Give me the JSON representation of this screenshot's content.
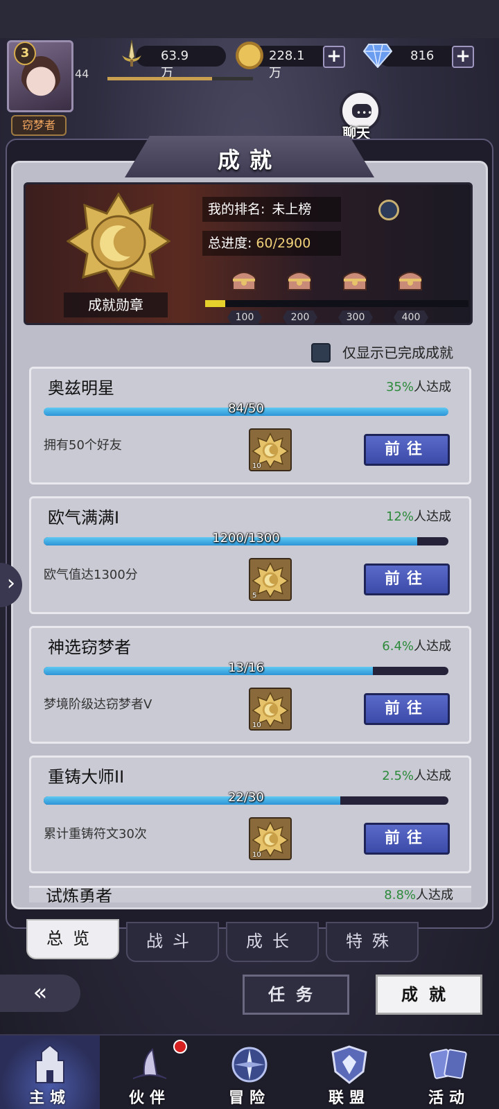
{
  "player": {
    "avatar_level": "3",
    "level": "44",
    "rank_title": "窃梦者",
    "exp_progress": 0.72
  },
  "resources": {
    "power": "63.9万",
    "gold": "228.1万",
    "gems": "816"
  },
  "chat": {
    "label": "聊天"
  },
  "title": "成就",
  "summary": {
    "rank_label": "我的排名:",
    "rank_value": "未上榜",
    "progress_label": "总进度:",
    "progress_value": "60/2900",
    "medal_label": "成就勋章",
    "milestones": [
      "100",
      "200",
      "300",
      "400"
    ],
    "milestone_fill": 0.075
  },
  "filter": {
    "label": "仅显示已完成成就",
    "checked": false
  },
  "achievements": [
    {
      "title": "奥兹明星",
      "pct": "35%",
      "pct_suffix": "人达成",
      "count": "84/50",
      "progress": 1.0,
      "desc": "拥有50个好友",
      "reward_count": "10",
      "button": "前往"
    },
    {
      "title": "欧气满满I",
      "pct": "12%",
      "pct_suffix": "人达成",
      "count": "1200/1300",
      "progress": 0.923,
      "desc": "欧气值达1300分",
      "reward_count": "5",
      "button": "前往"
    },
    {
      "title": "神选窃梦者",
      "pct": "6.4%",
      "pct_suffix": "人达成",
      "count": "13/16",
      "progress": 0.8125,
      "desc": "梦境阶级达窃梦者V",
      "reward_count": "10",
      "button": "前往"
    },
    {
      "title": "重铸大师II",
      "pct": "2.5%",
      "pct_suffix": "人达成",
      "count": "22/30",
      "progress": 0.733,
      "desc": "累计重铸符文30次",
      "reward_count": "10",
      "button": "前往"
    }
  ],
  "partial_card": {
    "title": "试炼勇者",
    "pct": "8.8%",
    "pct_suffix": "人达成"
  },
  "tabs": [
    "总览",
    "战斗",
    "成长",
    "特殊"
  ],
  "bottom_buttons": {
    "tasks": "任务",
    "achievements": "成就"
  },
  "nav": [
    "主城",
    "伙伴",
    "冒险",
    "联盟",
    "活动"
  ],
  "colors": {
    "accent_blue": "#2d95d6",
    "go_button": "#4a5ab8",
    "percent_green": "#2c8a3a"
  }
}
